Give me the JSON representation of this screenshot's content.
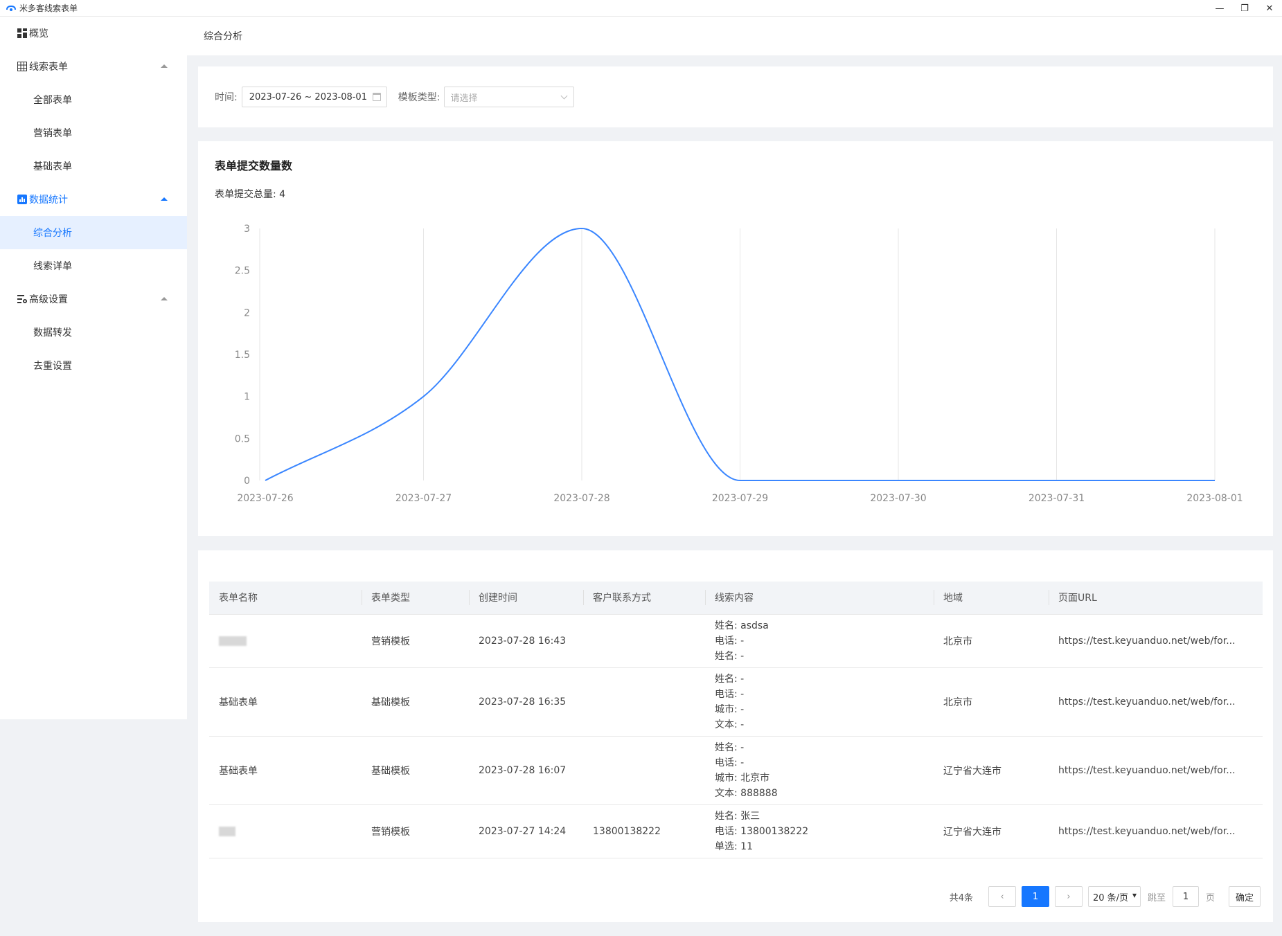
{
  "window": {
    "title": "米多客线索表单",
    "minimize": "—",
    "restore": "❐",
    "close": "✕"
  },
  "sidebar": {
    "items": [
      {
        "label": "概览",
        "icon": "dashboard-icon"
      },
      {
        "label": "线索表单",
        "icon": "table-icon",
        "children": [
          "全部表单",
          "营销表单",
          "基础表单"
        ]
      },
      {
        "label": "数据统计",
        "icon": "stats-icon",
        "children": [
          "综合分析",
          "线索详单"
        ]
      },
      {
        "label": "高级设置",
        "icon": "settings-icon",
        "children": [
          "数据转发",
          "去重设置"
        ]
      }
    ],
    "active_item": "综合分析"
  },
  "breadcrumb": "综合分析",
  "filters": {
    "time_label": "时间:",
    "date_range": "2023-07-26 ~ 2023-08-01",
    "template_label": "模板类型:",
    "template_placeholder": "请选择"
  },
  "chart_section": {
    "title": "表单提交数量数",
    "total_label": "表单提交总量:",
    "total_value": "4"
  },
  "chart_data": {
    "type": "line",
    "categories": [
      "2023-07-26",
      "2023-07-27",
      "2023-07-28",
      "2023-07-29",
      "2023-07-30",
      "2023-07-31",
      "2023-08-01"
    ],
    "series": [
      {
        "values": [
          0,
          1,
          3,
          0,
          0,
          0,
          0
        ]
      }
    ],
    "ylim": [
      0,
      3
    ],
    "yticks": [
      "0",
      "0.5",
      "1",
      "1.5",
      "2",
      "2.5",
      "3"
    ],
    "smooth": true,
    "color": "#3a86ff",
    "grid": "vertical"
  },
  "table": {
    "columns": [
      "表单名称",
      "表单类型",
      "创建时间",
      "客户联系方式",
      "线索内容",
      "地域",
      "页面URL"
    ],
    "rows": [
      {
        "name": "",
        "type": "营销模板",
        "created": "2023-07-28 16:43",
        "contact": "",
        "content": [
          "姓名: asdsa",
          "电话: -",
          "姓名: -"
        ],
        "region": "北京市",
        "url": "https://test.keyuanduo.net/web/for..."
      },
      {
        "name": "基础表单",
        "type": "基础模板",
        "created": "2023-07-28 16:35",
        "contact": "",
        "content": [
          "姓名: -",
          "电话: -",
          "城市: -",
          "文本: -"
        ],
        "region": "北京市",
        "url": "https://test.keyuanduo.net/web/for..."
      },
      {
        "name": "基础表单",
        "type": "基础模板",
        "created": "2023-07-28 16:07",
        "contact": "",
        "content": [
          "姓名: -",
          "电话: -",
          "城市: 北京市",
          "文本: 888888"
        ],
        "region": "辽宁省大连市",
        "url": "https://test.keyuanduo.net/web/for..."
      },
      {
        "name": "",
        "type": "营销模板",
        "created": "2023-07-27 14:24",
        "contact": "13800138222",
        "content": [
          "姓名: 张三",
          "电话: 13800138222",
          "单选: 11"
        ],
        "region": "辽宁省大连市",
        "url": "https://test.keyuanduo.net/web/for..."
      }
    ]
  },
  "pagination": {
    "total": "共4条",
    "prev": "‹",
    "current": "1",
    "next": "›",
    "page_size": "20 条/页",
    "jump_label": "跳至",
    "jump_value": "1",
    "page_unit": "页",
    "confirm": "确定"
  },
  "colors": {
    "accent": "#1677ff",
    "line": "#3a86ff"
  }
}
